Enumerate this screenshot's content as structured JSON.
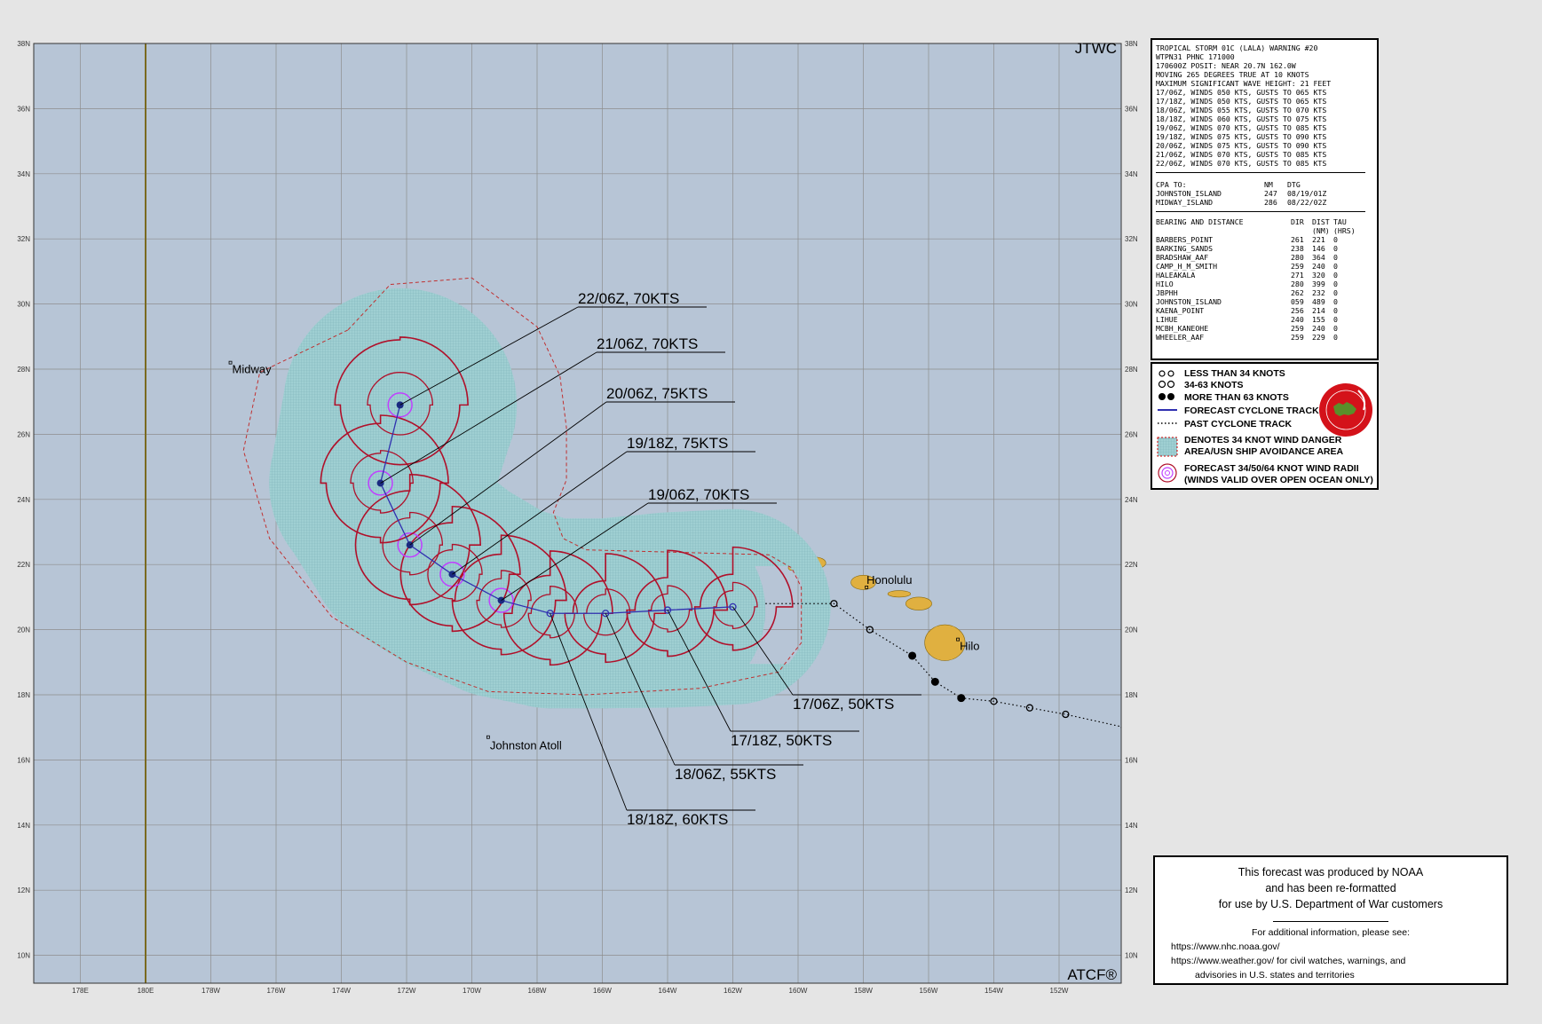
{
  "map": {
    "corner_top": "JTWC",
    "corner_bottom": "ATCF®",
    "lat_labels": [
      "38N",
      "36N",
      "34N",
      "32N",
      "30N",
      "28N",
      "26N",
      "24N",
      "22N",
      "20N",
      "18N",
      "16N",
      "14N",
      "12N",
      "10N"
    ],
    "lon_labels": [
      "178E",
      "180E",
      "178W",
      "176W",
      "174W",
      "172W",
      "170W",
      "168W",
      "166W",
      "164W",
      "162W",
      "160W",
      "158W",
      "156W",
      "154W",
      "152W"
    ],
    "places": [
      {
        "name": "Midway",
        "lon": -177.4,
        "lat": 28.2
      },
      {
        "name": "Johnston Atoll",
        "lon": -169.5,
        "lat": 16.7
      },
      {
        "name": "Honolulu",
        "lon": -157.9,
        "lat": 21.3
      },
      {
        "name": "Hilo",
        "lon": -155.1,
        "lat": 19.7
      }
    ],
    "forecast_track": [
      {
        "time": "17/06Z",
        "lon": -162.0,
        "lat": 20.7,
        "winds_kts": 50,
        "label": "17/06Z,  50KTS"
      },
      {
        "time": "17/18Z",
        "lon": -164.0,
        "lat": 20.6,
        "winds_kts": 50,
        "label": "17/18Z,  50KTS"
      },
      {
        "time": "18/06Z",
        "lon": -165.9,
        "lat": 20.5,
        "winds_kts": 55,
        "label": "18/06Z,  55KTS"
      },
      {
        "time": "18/18Z",
        "lon": -167.6,
        "lat": 20.5,
        "winds_kts": 60,
        "label": "18/18Z,  60KTS"
      },
      {
        "time": "19/06Z",
        "lon": -169.1,
        "lat": 20.9,
        "winds_kts": 70,
        "label": "19/06Z,  70KTS"
      },
      {
        "time": "19/18Z",
        "lon": -170.6,
        "lat": 21.7,
        "winds_kts": 75,
        "label": "19/18Z,  75KTS"
      },
      {
        "time": "20/06Z",
        "lon": -171.9,
        "lat": 22.6,
        "winds_kts": 75,
        "label": "20/06Z,  75KTS"
      },
      {
        "time": "21/06Z",
        "lon": -172.8,
        "lat": 24.5,
        "winds_kts": 70,
        "label": "21/06Z,  70KTS"
      },
      {
        "time": "22/06Z",
        "lon": -172.2,
        "lat": 26.9,
        "winds_kts": 70,
        "label": "22/06Z,  70KTS"
      }
    ],
    "past_track": [
      {
        "lon": -161.0,
        "lat": 20.8
      },
      {
        "lon": -158.9,
        "lat": 20.8
      },
      {
        "lon": -157.8,
        "lat": 20.0
      },
      {
        "lon": -156.5,
        "lat": 19.2
      },
      {
        "lon": -155.8,
        "lat": 18.4
      },
      {
        "lon": -155.0,
        "lat": 17.9
      },
      {
        "lon": -154.0,
        "lat": 17.8
      },
      {
        "lon": -152.9,
        "lat": 17.6
      },
      {
        "lon": -151.8,
        "lat": 17.4
      },
      {
        "lon": -150.0,
        "lat": 17.0
      }
    ],
    "colors": {
      "ocean": "#b7c5d6",
      "grid": "#8d8d8d",
      "danger": "#9fcfd2",
      "radii34": "#b0102a",
      "radii64": "#c040ff",
      "track": "#3030b0",
      "land": "#e0b040",
      "dateline": "#7a6a20"
    }
  },
  "warning": {
    "header_lines": [
      "TROPICAL STORM 01C (LALA) WARNING #20",
      "WTPN31 PHNC 171000",
      "170600Z POSIT: NEAR 20.7N 162.0W",
      "MOVING 265 DEGREES TRUE AT 10 KNOTS",
      "MAXIMUM SIGNIFICANT WAVE HEIGHT: 21 FEET",
      "17/06Z, WINDS 050 KTS, GUSTS TO 065 KTS",
      "17/18Z, WINDS 050 KTS, GUSTS TO 065 KTS",
      "18/06Z, WINDS 055 KTS, GUSTS TO 070 KTS",
      "18/18Z, WINDS 060 KTS, GUSTS TO 075 KTS",
      "19/06Z, WINDS 070 KTS, GUSTS TO 085 KTS",
      "19/18Z, WINDS 075 KTS, GUSTS TO 090 KTS",
      "20/06Z, WINDS 075 KTS, GUSTS TO 090 KTS",
      "21/06Z, WINDS 070 KTS, GUSTS TO 085 KTS",
      "22/06Z, WINDS 070 KTS, GUSTS TO 085 KTS"
    ],
    "cpa_header": [
      "CPA TO:",
      "NM",
      "DTG"
    ],
    "cpa_rows": [
      [
        "JOHNSTON_ISLAND",
        "247",
        "08/19/01Z"
      ],
      [
        "MIDWAY_ISLAND",
        "286",
        "08/22/02Z"
      ]
    ],
    "bd_header": [
      "BEARING AND DISTANCE",
      "DIR",
      "DIST",
      "TAU"
    ],
    "bd_units": [
      "",
      "",
      "(NM)",
      "(HRS)"
    ],
    "bd_rows": [
      [
        "BARBERS_POINT",
        "261",
        "221",
        "0"
      ],
      [
        "BARKING_SANDS",
        "238",
        "146",
        "0"
      ],
      [
        "BRADSHAW_AAF",
        "280",
        "364",
        "0"
      ],
      [
        "CAMP_H_M_SMITH",
        "259",
        "240",
        "0"
      ],
      [
        "HALEAKALA",
        "271",
        "320",
        "0"
      ],
      [
        "HILO",
        "280",
        "399",
        "0"
      ],
      [
        "JBPHH",
        "262",
        "232",
        "0"
      ],
      [
        "JOHNSTON_ISLAND",
        "059",
        "489",
        "0"
      ],
      [
        "KAENA_POINT",
        "256",
        "214",
        "0"
      ],
      [
        "LIHUE",
        "240",
        "155",
        "0"
      ],
      [
        "MCBH_KANEOHE",
        "259",
        "240",
        "0"
      ],
      [
        "WHEELER_AAF",
        "259",
        "229",
        "0"
      ]
    ]
  },
  "legend": {
    "items": [
      "LESS THAN 34 KNOTS",
      "34-63 KNOTS",
      "MORE THAN 63 KNOTS",
      "FORECAST CYCLONE TRACK",
      "PAST CYCLONE TRACK",
      "DENOTES 34 KNOT WIND DANGER",
      "AREA/USN SHIP AVOIDANCE AREA",
      "FORECAST 34/50/64 KNOT WIND RADII",
      "(WINDS VALID OVER OPEN OCEAN ONLY)"
    ]
  },
  "credits": {
    "l1": "This forecast was produced by NOAA",
    "l2": "and has been re-formatted",
    "l3": "for use by U.S. Department of War customers",
    "l4": "For additional information, please see:",
    "l5": "https://www.nhc.noaa.gov/",
    "l6": "https://www.weather.gov/ for civil watches, warnings, and",
    "l7": "advisories in U.S. states and territories"
  }
}
